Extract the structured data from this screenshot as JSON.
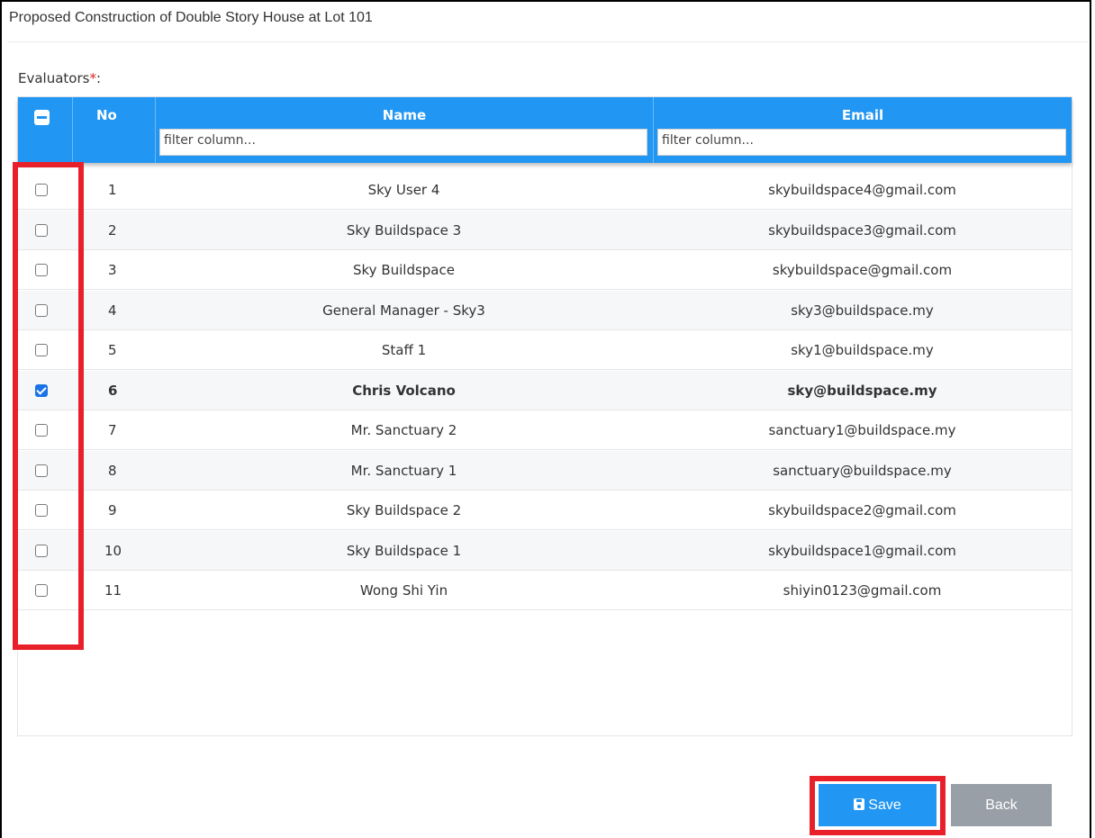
{
  "page": {
    "title": "Proposed Construction of Double Story House at Lot 101"
  },
  "evaluators": {
    "label": "Evaluators",
    "required_mark": "*",
    "label_suffix": ":"
  },
  "table": {
    "columns": {
      "no": "No",
      "name": "Name",
      "email": "Email"
    },
    "name_filter_placeholder": "filter column...",
    "email_filter_placeholder": "filter column...",
    "rows": [
      {
        "no": "1",
        "name": "Sky User 4",
        "email": "skybuildspace4@gmail.com",
        "checked": false
      },
      {
        "no": "2",
        "name": "Sky Buildspace 3",
        "email": "skybuildspace3@gmail.com",
        "checked": false
      },
      {
        "no": "3",
        "name": "Sky Buildspace",
        "email": "skybuildspace@gmail.com",
        "checked": false
      },
      {
        "no": "4",
        "name": "General Manager - Sky3",
        "email": "sky3@buildspace.my",
        "checked": false
      },
      {
        "no": "5",
        "name": "Staff 1",
        "email": "sky1@buildspace.my",
        "checked": false
      },
      {
        "no": "6",
        "name": "Chris Volcano",
        "email": "sky@buildspace.my",
        "checked": true
      },
      {
        "no": "7",
        "name": "Mr. Sanctuary 2",
        "email": "sanctuary1@buildspace.my",
        "checked": false
      },
      {
        "no": "8",
        "name": "Mr. Sanctuary 1",
        "email": "sanctuary@buildspace.my",
        "checked": false
      },
      {
        "no": "9",
        "name": "Sky Buildspace 2",
        "email": "skybuildspace2@gmail.com",
        "checked": false
      },
      {
        "no": "10",
        "name": "Sky Buildspace 1",
        "email": "skybuildspace1@gmail.com",
        "checked": false
      },
      {
        "no": "11",
        "name": "Wong Shi Yin",
        "email": "shiyin0123@gmail.com",
        "checked": false
      }
    ]
  },
  "actions": {
    "save_label": "Save",
    "back_label": "Back",
    "save_icon": "floppy-disk-icon"
  },
  "colors": {
    "header_blue": "#2196f3",
    "highlight_red": "#e8202a",
    "back_gray": "#999fa7"
  }
}
